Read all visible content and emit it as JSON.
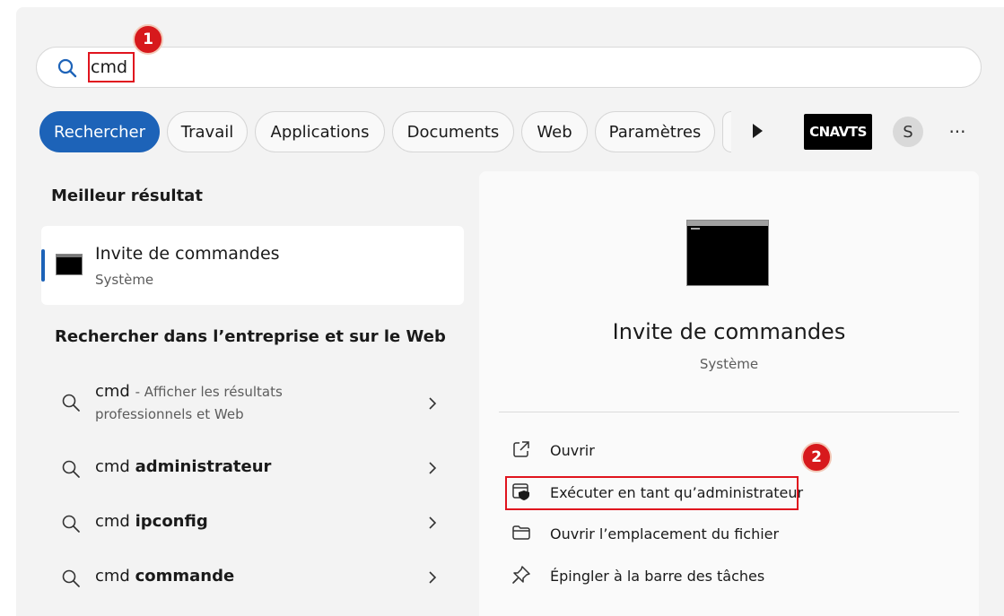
{
  "search": {
    "value": "cmd"
  },
  "annotations": {
    "step1": "1",
    "step2": "2"
  },
  "tabs": [
    {
      "label": "Rechercher",
      "active": true
    },
    {
      "label": "Travail"
    },
    {
      "label": "Applications"
    },
    {
      "label": "Documents"
    },
    {
      "label": "Web"
    },
    {
      "label": "Paramètres"
    }
  ],
  "org_badge": "CNAVTS",
  "avatar_initial": "S",
  "more_label": "···",
  "best_result": {
    "heading": "Meilleur résultat",
    "title": "Invite de commandes",
    "subtitle": "Système"
  },
  "web_search": {
    "heading": "Rechercher dans l’entreprise et sur le Web",
    "items": [
      {
        "prefix": "cmd",
        "suffix": "- Afficher les résultats",
        "line2": "professionnels et Web"
      },
      {
        "prefix": "cmd",
        "bold": "administrateur"
      },
      {
        "prefix": "cmd",
        "bold": "ipconfig"
      },
      {
        "prefix": "cmd",
        "bold": "commande"
      }
    ]
  },
  "detail": {
    "title": "Invite de commandes",
    "subtitle": "Système",
    "actions": [
      {
        "label": "Ouvrir",
        "icon": "open-external-icon"
      },
      {
        "label": "Exécuter en tant qu’administrateur",
        "icon": "run-as-admin-icon"
      },
      {
        "label": "Ouvrir l’emplacement du fichier",
        "icon": "folder-icon"
      },
      {
        "label": "Épingler à la barre des tâches",
        "icon": "pin-icon"
      }
    ]
  },
  "colors": {
    "accent": "#1d63b8",
    "highlight": "#e0141e",
    "badge": "#d7191c"
  }
}
